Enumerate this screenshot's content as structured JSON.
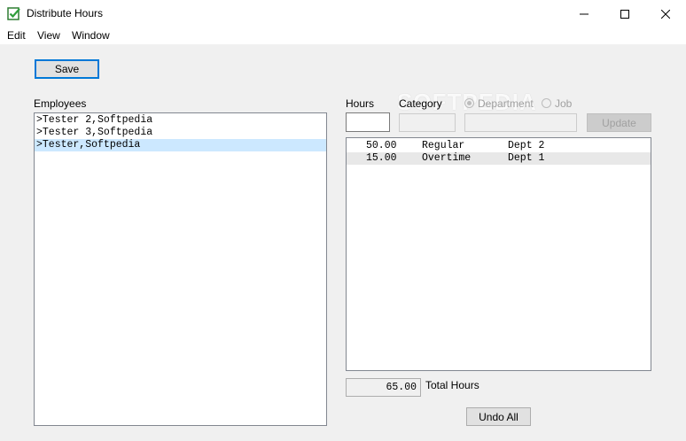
{
  "window": {
    "title": "Distribute Hours"
  },
  "menu": {
    "items": [
      "Edit",
      "View",
      "Window"
    ]
  },
  "toolbar": {
    "save_label": "Save"
  },
  "employees": {
    "label": "Employees",
    "items": [
      ">Tester 2,Softpedia",
      ">Tester 3,Softpedia",
      ">Tester,Softpedia"
    ],
    "selected_index": 2
  },
  "entry": {
    "hours_label": "Hours",
    "category_label": "Category",
    "department_label": "Department",
    "job_label": "Job",
    "update_label": "Update",
    "hours_value": ""
  },
  "hours_list": {
    "rows": [
      {
        "hours": "50.00",
        "type": "Regular",
        "dept": "Dept 2"
      },
      {
        "hours": "15.00",
        "type": "Overtime",
        "dept": "Dept 1"
      }
    ]
  },
  "totals": {
    "value": "65.00",
    "label": "Total Hours"
  },
  "undo_all_label": "Undo All",
  "watermark": "SOFTPEDIA",
  "colors": {
    "selection": "#cce8ff",
    "accent": "#0078d7"
  }
}
